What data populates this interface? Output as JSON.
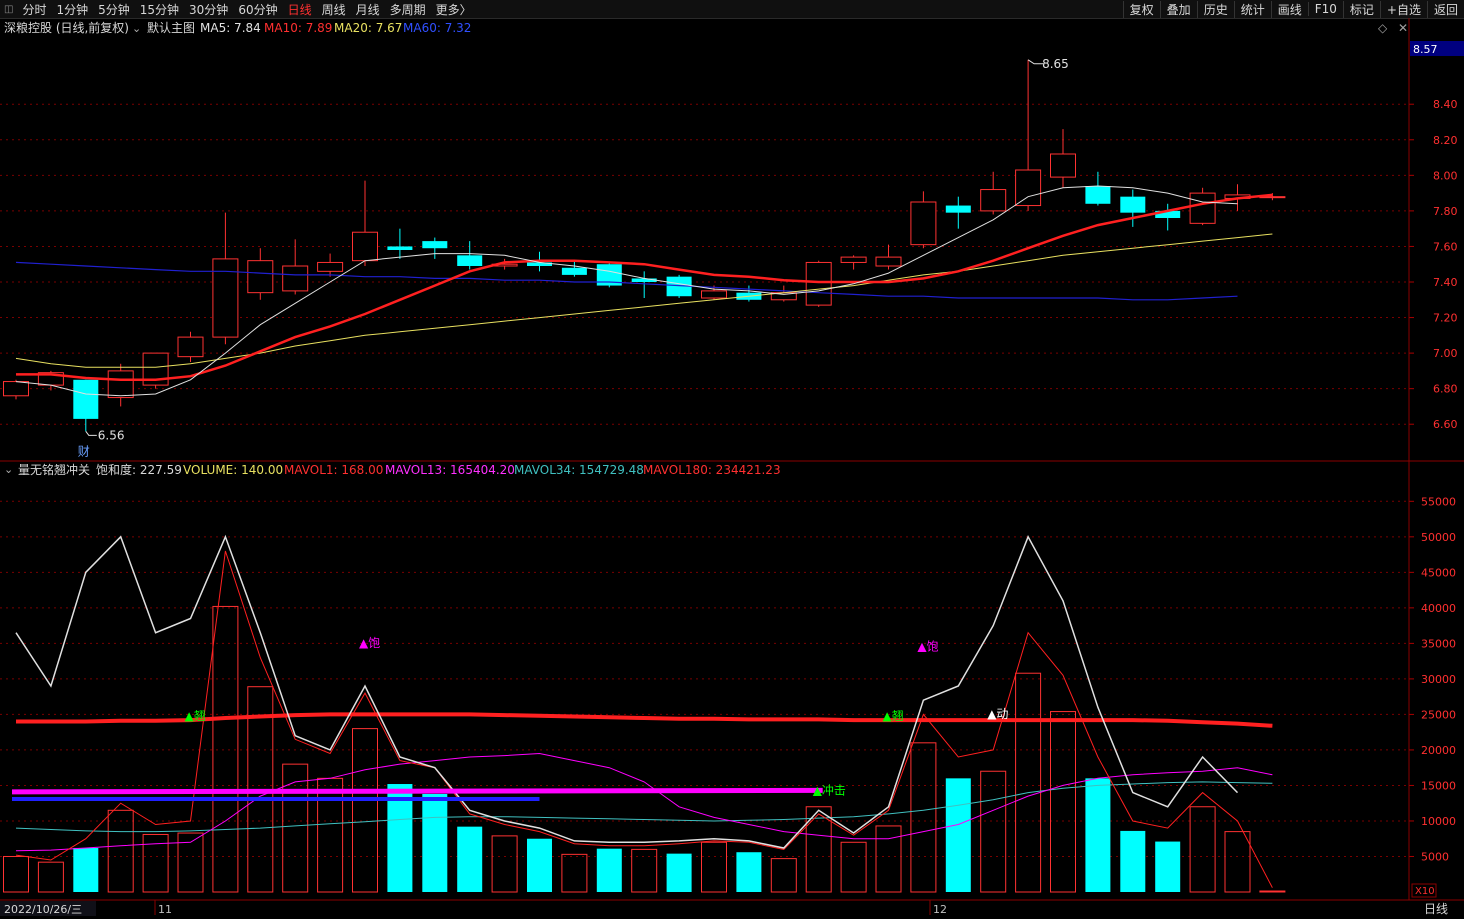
{
  "toolbar": {
    "periods": [
      "分时",
      "1分钟",
      "5分钟",
      "15分钟",
      "30分钟",
      "60分钟",
      "日线",
      "周线",
      "月线",
      "多周期",
      "更多〉"
    ],
    "active_period": "日线",
    "right_buttons": [
      "复权",
      "叠加",
      "历史",
      "统计",
      "画线",
      "F10",
      "标记",
      "+自选",
      "返回"
    ]
  },
  "colors": {
    "up": "#ff3232",
    "down": "#00ffff",
    "ma5": "#e0e0e0",
    "ma10": "#ff2020",
    "ma20": "#e8e060",
    "ma60": "#2020d0",
    "mavol13": "#ff00ff",
    "mavol34": "#40c0c0",
    "mavol180": "#ff2020",
    "grid": "#7a0000"
  },
  "main_legend": {
    "stock": "深粮控股 (日线,前复权)",
    "layout": "默认主图",
    "ma5": "MA5: 7.84",
    "ma10": "MA10: 7.89",
    "ma20": "MA20: 7.67",
    "ma60": "MA60: 7.32"
  },
  "sub_legend": {
    "indicator": "量无铭翘冲关",
    "saturation": "饱和度: 227.59",
    "volume": "VOLUME: 140.00",
    "mavol1": "MAVOL1: 168.00",
    "mavol13": "MAVOL13: 165404.20",
    "mavol34": "MAVOL34: 154729.48",
    "mavol180": "MAVOL180: 234421.23"
  },
  "price_badge": "8.57",
  "bottom": {
    "date": "2022/10/26/三",
    "month1": "11",
    "month2": "12",
    "period": "日线",
    "scale": "X10"
  },
  "chart_data": [
    {
      "type": "candlestick",
      "title": "深粮控股 (日线,前复权)",
      "ylim": [
        6.5,
        8.75
      ],
      "y_ticks": [
        "6.60",
        "6.80",
        "7.00",
        "7.20",
        "7.40",
        "7.60",
        "7.80",
        "8.00",
        "8.20",
        "8.40"
      ],
      "high_label": "8.65",
      "low_label": "6.56",
      "candles": [
        [
          6.76,
          6.84,
          6.74,
          6.85
        ],
        [
          6.82,
          6.89,
          6.79,
          6.9
        ],
        [
          6.85,
          6.63,
          6.56,
          6.85
        ],
        [
          6.75,
          6.9,
          6.7,
          6.94
        ],
        [
          6.82,
          7.0,
          6.8,
          7.0
        ],
        [
          6.98,
          7.09,
          6.95,
          7.12
        ],
        [
          7.09,
          7.53,
          7.05,
          7.79
        ],
        [
          7.34,
          7.52,
          7.3,
          7.59
        ],
        [
          7.35,
          7.49,
          7.33,
          7.64
        ],
        [
          7.46,
          7.51,
          7.43,
          7.56
        ],
        [
          7.52,
          7.68,
          7.49,
          7.97
        ],
        [
          7.6,
          7.58,
          7.53,
          7.7
        ],
        [
          7.63,
          7.59,
          7.53,
          7.65
        ],
        [
          7.55,
          7.49,
          7.47,
          7.63
        ],
        [
          7.49,
          7.5,
          7.47,
          7.53
        ],
        [
          7.51,
          7.49,
          7.46,
          7.57
        ],
        [
          7.48,
          7.44,
          7.43,
          7.52
        ],
        [
          7.5,
          7.38,
          7.37,
          7.51
        ],
        [
          7.42,
          7.4,
          7.31,
          7.46
        ],
        [
          7.43,
          7.32,
          7.31,
          7.44
        ],
        [
          7.31,
          7.35,
          7.3,
          7.38
        ],
        [
          7.34,
          7.3,
          7.29,
          7.38
        ],
        [
          7.3,
          7.34,
          7.29,
          7.38
        ],
        [
          7.27,
          7.51,
          7.26,
          7.52
        ],
        [
          7.51,
          7.54,
          7.47,
          7.55
        ],
        [
          7.49,
          7.54,
          7.47,
          7.61
        ],
        [
          7.61,
          7.85,
          7.59,
          7.91
        ],
        [
          7.83,
          7.79,
          7.7,
          7.88
        ],
        [
          7.8,
          7.92,
          7.78,
          8.02
        ],
        [
          7.83,
          8.03,
          7.8,
          8.65
        ],
        [
          7.99,
          8.12,
          7.93,
          8.26
        ],
        [
          7.94,
          7.84,
          7.83,
          8.02
        ],
        [
          7.88,
          7.79,
          7.71,
          7.92
        ],
        [
          7.8,
          7.76,
          7.69,
          7.84
        ],
        [
          7.73,
          7.9,
          7.72,
          7.93
        ],
        [
          7.87,
          7.89,
          7.8,
          7.95
        ],
        [
          7.88,
          7.88,
          7.86,
          7.9
        ]
      ],
      "ma5": [
        6.84,
        6.82,
        6.77,
        6.76,
        6.77,
        6.85,
        7.0,
        7.16,
        7.28,
        7.4,
        7.52,
        7.54,
        7.56,
        7.56,
        7.55,
        7.51,
        7.49,
        7.46,
        7.42,
        7.39,
        7.36,
        7.35,
        7.33,
        7.35,
        7.39,
        7.45,
        7.55,
        7.65,
        7.75,
        7.88,
        7.93,
        7.94,
        7.93,
        7.9,
        7.85,
        7.84
      ],
      "ma10": [
        6.88,
        6.88,
        6.86,
        6.85,
        6.85,
        6.87,
        6.93,
        7.01,
        7.09,
        7.15,
        7.22,
        7.3,
        7.38,
        7.46,
        7.51,
        7.52,
        7.52,
        7.51,
        7.5,
        7.47,
        7.44,
        7.43,
        7.41,
        7.4,
        7.4,
        7.4,
        7.42,
        7.46,
        7.52,
        7.59,
        7.66,
        7.72,
        7.76,
        7.8,
        7.84,
        7.87,
        7.89
      ],
      "ma20": [
        6.97,
        6.94,
        6.92,
        6.92,
        6.92,
        6.94,
        6.97,
        7.0,
        7.04,
        7.07,
        7.1,
        7.12,
        7.14,
        7.16,
        7.18,
        7.2,
        7.22,
        7.24,
        7.26,
        7.28,
        7.3,
        7.32,
        7.34,
        7.36,
        7.38,
        7.41,
        7.44,
        7.46,
        7.49,
        7.52,
        7.55,
        7.57,
        7.59,
        7.61,
        7.63,
        7.65,
        7.67
      ],
      "ma60": [
        7.51,
        7.5,
        7.49,
        7.48,
        7.47,
        7.46,
        7.46,
        7.45,
        7.44,
        7.44,
        7.43,
        7.43,
        7.42,
        7.42,
        7.41,
        7.41,
        7.4,
        7.4,
        7.39,
        7.38,
        7.37,
        7.36,
        7.35,
        7.34,
        7.33,
        7.32,
        7.32,
        7.31,
        7.31,
        7.31,
        7.31,
        7.31,
        7.3,
        7.3,
        7.31,
        7.32
      ],
      "marker": "财"
    },
    {
      "type": "bar",
      "title": "量无铭翘冲关",
      "ylim": [
        0,
        58000
      ],
      "y_ticks": [
        "5000",
        "10000",
        "15000",
        "20000",
        "25000",
        "30000",
        "35000",
        "40000",
        "45000",
        "50000",
        "55000"
      ],
      "volume": [
        5000,
        4200,
        6200,
        11500,
        8100,
        8300,
        40200,
        28900,
        18000,
        16000,
        23000,
        15200,
        13800,
        9200,
        7900,
        7500,
        5300,
        6100,
        6000,
        5400,
        7000,
        5600,
        4700,
        12000,
        7000,
        9300,
        21000,
        16000,
        17000,
        30800,
        25400,
        16000,
        8600,
        7100,
        12000,
        8500,
        140
      ],
      "down": [
        false,
        false,
        true,
        false,
        false,
        false,
        false,
        false,
        false,
        false,
        false,
        true,
        true,
        true,
        false,
        true,
        false,
        true,
        false,
        true,
        false,
        true,
        false,
        false,
        false,
        false,
        false,
        true,
        false,
        false,
        false,
        true,
        true,
        true,
        false,
        false,
        false
      ],
      "white_line": [
        36500,
        29000,
        45000,
        50000,
        36500,
        38500,
        50000,
        36500,
        22000,
        20000,
        29000,
        19000,
        17500,
        11500,
        10000,
        9000,
        7200,
        7000,
        7000,
        7200,
        7500,
        7200,
        6200,
        11500,
        8300,
        12000,
        27000,
        29000,
        37500,
        50000,
        41000,
        26000,
        14000,
        12000,
        19000,
        14000
      ],
      "red_line": [
        5200,
        4500,
        7500,
        12500,
        9500,
        10000,
        48000,
        33000,
        21500,
        19500,
        28000,
        18500,
        17500,
        11000,
        9500,
        8500,
        6800,
        6500,
        6500,
        6800,
        7200,
        7000,
        6000,
        11000,
        8000,
        11500,
        25000,
        19000,
        20000,
        36500,
        30500,
        19000,
        10000,
        9000,
        14000,
        10000,
        600
      ],
      "mavol13": [
        5800,
        5900,
        6200,
        6500,
        6800,
        7000,
        10000,
        13500,
        15500,
        16000,
        17200,
        18000,
        18500,
        19000,
        19200,
        19500,
        18500,
        17500,
        15500,
        12000,
        10500,
        9500,
        8500,
        8000,
        7500,
        7500,
        8500,
        9500,
        11500,
        13500,
        15000,
        16000,
        16500,
        16800,
        17000,
        17500,
        16500
      ],
      "mavol34": [
        9000,
        8800,
        8600,
        8500,
        8500,
        8600,
        8800,
        9000,
        9300,
        9600,
        9900,
        10200,
        10500,
        10600,
        10600,
        10500,
        10400,
        10300,
        10200,
        10100,
        10000,
        10100,
        10200,
        10400,
        10600,
        11000,
        11500,
        12200,
        13000,
        14000,
        14600,
        15000,
        15200,
        15400,
        15500,
        15400,
        15300
      ],
      "mavol180": [
        24000,
        24000,
        24000,
        24100,
        24100,
        24200,
        24500,
        24700,
        24900,
        25000,
        25000,
        25000,
        25000,
        25000,
        24900,
        24800,
        24700,
        24600,
        24500,
        24400,
        24400,
        24300,
        24300,
        24300,
        24200,
        24200,
        24200,
        24200,
        24200,
        24200,
        24200,
        24200,
        24200,
        24100,
        23900,
        23700,
        23400
      ],
      "magenta_band": [
        14100,
        14300
      ],
      "blue_band": 13100,
      "signals": [
        {
          "text": "▲饱",
          "i": 10,
          "v": 34500,
          "color": "#ff00ff"
        },
        {
          "text": "▲翘",
          "i": 5,
          "v": 24200,
          "color": "#00ff00"
        },
        {
          "text": "▲饱",
          "i": 26,
          "v": 34000,
          "color": "#ff00ff"
        },
        {
          "text": "▲翘",
          "i": 25,
          "v": 24200,
          "color": "#00ff00"
        },
        {
          "text": "▲动",
          "i": 28,
          "v": 24500,
          "color": "#ffffff"
        },
        {
          "text": "▲冲击",
          "i": 23,
          "v": 13700,
          "color": "#00ff00"
        }
      ]
    }
  ]
}
